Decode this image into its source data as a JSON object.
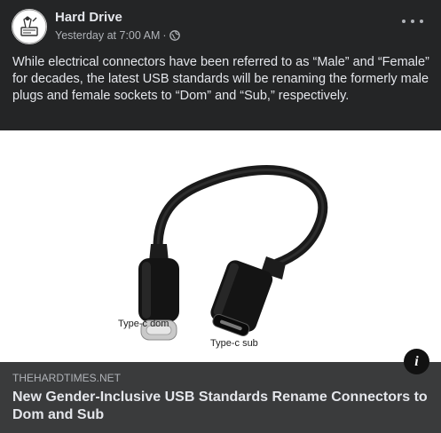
{
  "post": {
    "page_name": "Hard Drive",
    "timestamp": "Yesterday at 7:00 AM",
    "separator": "·",
    "audience_icon": "globe-icon",
    "more_icon": "more-options-icon",
    "text": "While electrical connectors have been referred to as “Male” and “Female” for decades, the latest USB standards will be renaming the formerly male plugs and female sockets to “Dom” and “Sub,” respectively."
  },
  "image": {
    "label_left": "Type-c dom",
    "label_right": "Type-c sub"
  },
  "link": {
    "domain": "THEHARDTIMES.NET",
    "title": "New Gender-Inclusive USB Standards Rename Connectors to Dom and Sub",
    "info_icon": "info-icon",
    "info_glyph": "i"
  },
  "colors": {
    "background": "#242526",
    "link_card": "#3a3b3c",
    "primary_text": "#e4e6eb",
    "secondary_text": "#b0b3b8"
  }
}
